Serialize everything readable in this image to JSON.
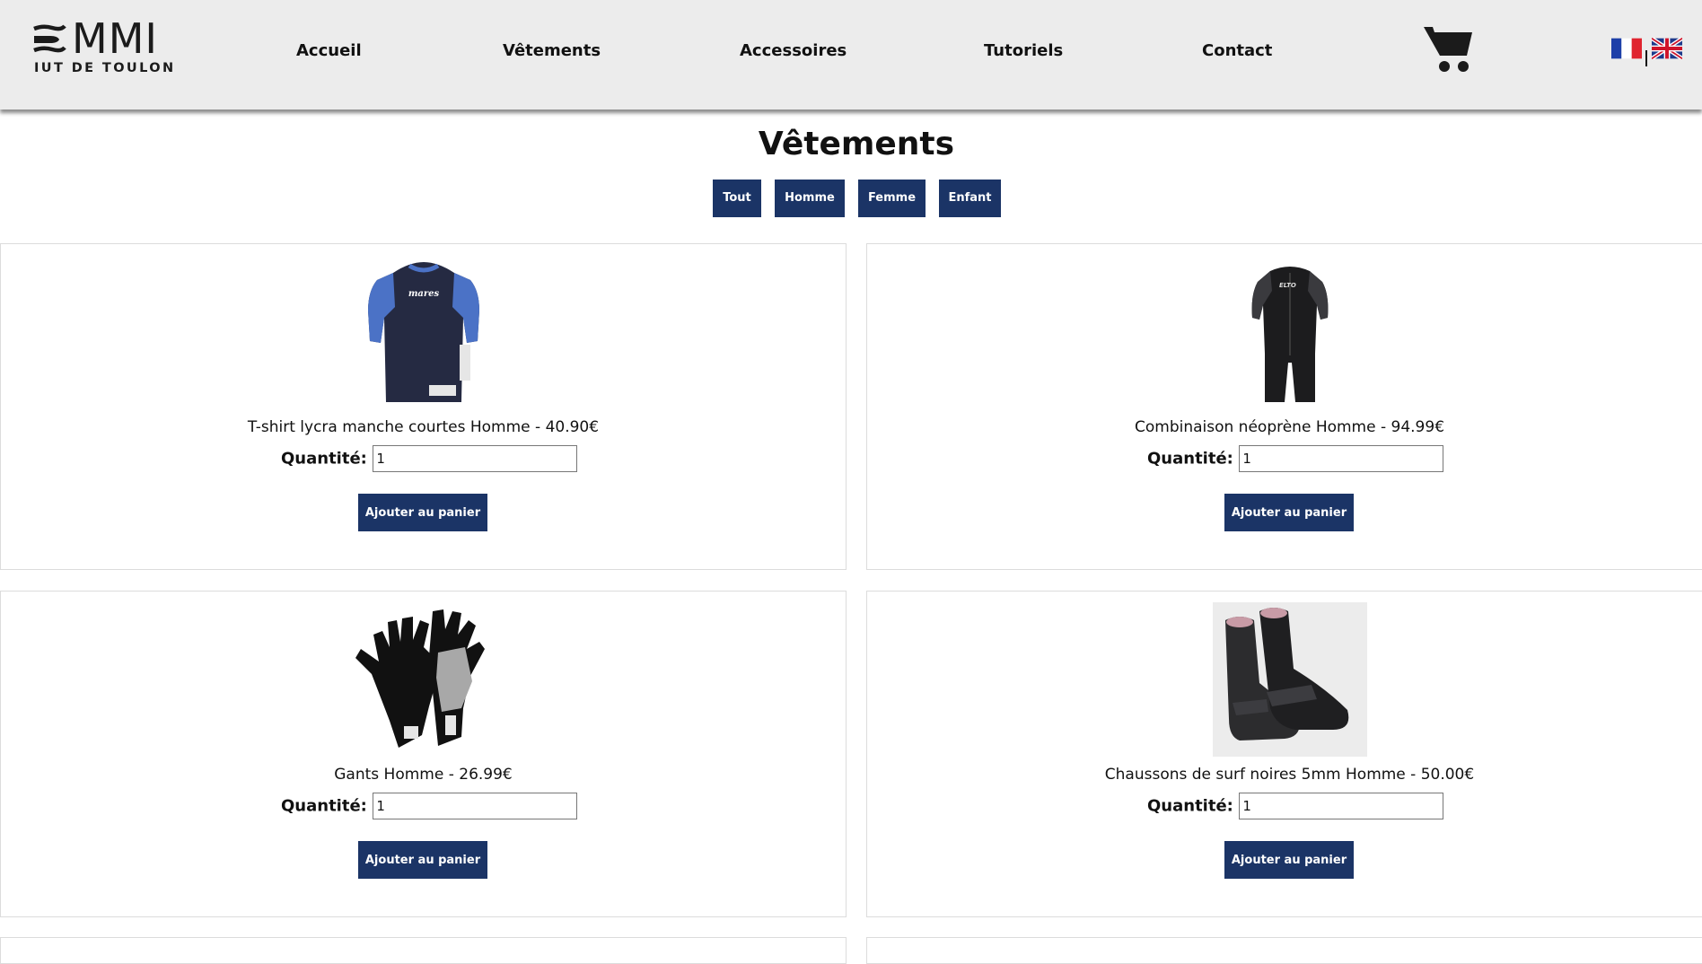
{
  "brand": {
    "logo_text": "MMI",
    "logo_subtext": "IUT DE TOULON"
  },
  "nav": {
    "items": [
      {
        "label": "Accueil"
      },
      {
        "label": "Vêtements"
      },
      {
        "label": "Accessoires"
      },
      {
        "label": "Tutoriels"
      },
      {
        "label": "Contact"
      }
    ],
    "cart_icon": "shopping-cart-icon",
    "languages": [
      "french-flag-icon",
      "uk-flag-icon"
    ]
  },
  "page": {
    "title": "Vêtements",
    "filters": [
      {
        "label": "Tout"
      },
      {
        "label": "Homme"
      },
      {
        "label": "Femme"
      },
      {
        "label": "Enfant"
      }
    ]
  },
  "products": [
    {
      "name": "T-shirt lycra manche courtes Homme - 40.90€",
      "quantity_label": "Quantité:",
      "quantity": "1",
      "button": "Ajouter au panier",
      "image_brand": "mares"
    },
    {
      "name": "Combinaison néoprène Homme - 94.99€",
      "quantity_label": "Quantité:",
      "quantity": "1",
      "button": "Ajouter au panier",
      "image_brand": "ELTO"
    },
    {
      "name": "Gants Homme - 26.99€",
      "quantity_label": "Quantité:",
      "quantity": "1",
      "button": "Ajouter au panier"
    },
    {
      "name": "Chaussons de surf noires 5mm Homme - 50.00€",
      "quantity_label": "Quantité:",
      "quantity": "1",
      "button": "Ajouter au panier"
    }
  ],
  "colors": {
    "header_bg": "#ececec",
    "button_bg": "#1b3466",
    "button_text": "#ffffff",
    "card_border": "#dcdcdc"
  }
}
